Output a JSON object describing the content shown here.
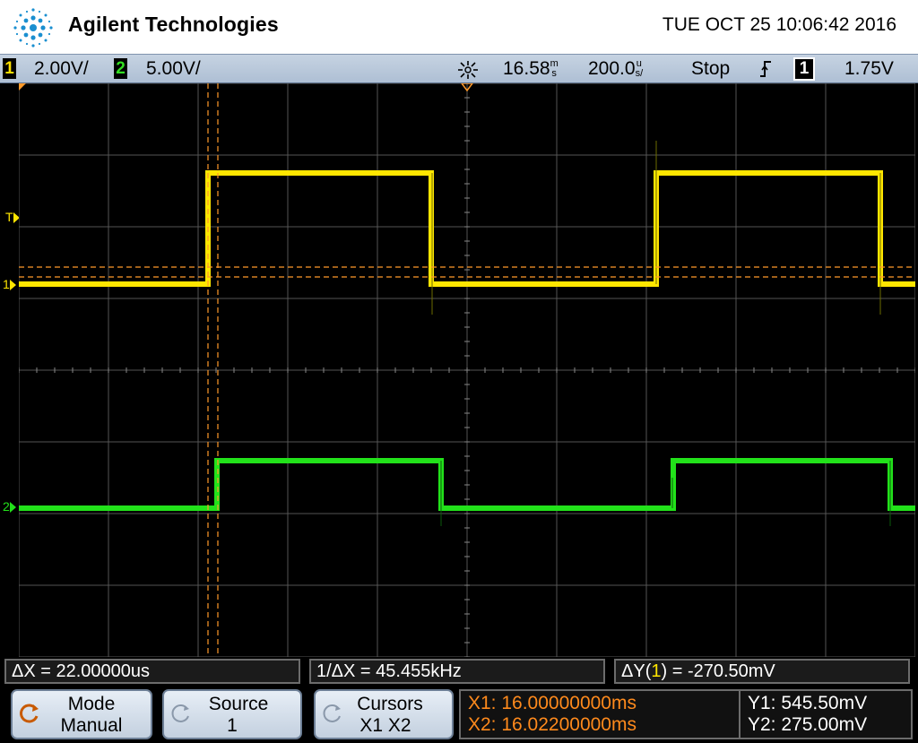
{
  "header": {
    "brand": "Agilent Technologies",
    "datetime": "TUE OCT 25 10:06:42 2016"
  },
  "status": {
    "ch1_num": "1",
    "ch1_scale": "2.00V/",
    "ch2_num": "2",
    "ch2_scale": "5.00V/",
    "acq_icon": "sunburst-icon",
    "time_offset": "16.58",
    "time_offset_unit": "m",
    "time_offset_unit2": "s",
    "timebase": "200.0",
    "timebase_unit": "u",
    "timebase_unit2": "s/",
    "run_state": "Stop",
    "trigger_slope_icon": "rising-edge-icon",
    "trigger_source": "1",
    "trigger_level": "1.75V"
  },
  "screen_markers": {
    "trigger_marker": "T",
    "ch1_marker": "1",
    "ch2_marker": "2"
  },
  "measurements": {
    "delta_x": "ΔX = 22.00000us",
    "inv_delta_x": "1/ΔX = 45.455kHz",
    "delta_y_prefix": "ΔY(",
    "delta_y_ch": "1",
    "delta_y_suffix": ") = -270.50mV"
  },
  "softkeys": {
    "mode_label": "Mode",
    "mode_value": "Manual",
    "source_label": "Source",
    "source_value": "1",
    "cursors_label": "Cursors",
    "cursors_value": "X1 X2"
  },
  "cursor_readout": {
    "x1": "X1: 16.00000000ms",
    "x2": "X2: 16.02200000ms",
    "y1": "Y1: 545.50mV",
    "y2": "Y2: 275.00mV"
  },
  "colors": {
    "ch1": "#ffe600",
    "ch2": "#22e21a",
    "cursor": "#ff9a2a",
    "grid": "#5a5a5a"
  }
}
